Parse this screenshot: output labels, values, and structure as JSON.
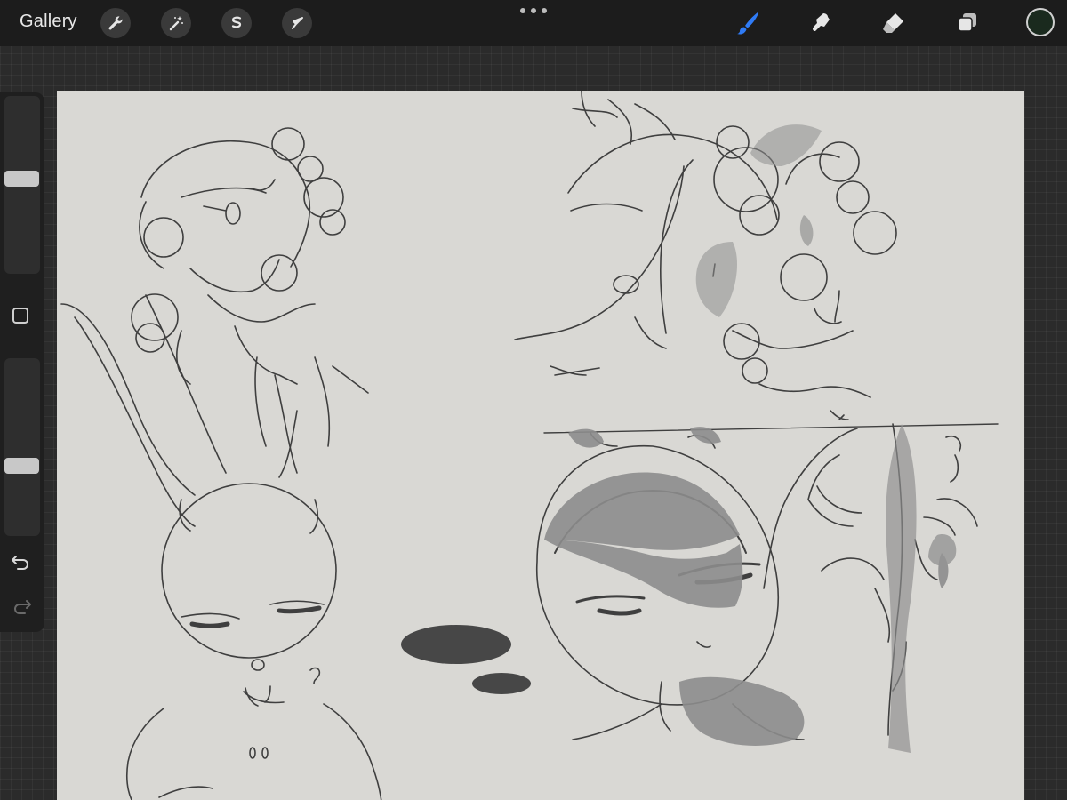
{
  "topbar": {
    "gallery_label": "Gallery",
    "left_tools": [
      "wrench-icon",
      "magic-wand-icon",
      "selection-icon",
      "transform-arrow-icon"
    ],
    "right_tools": [
      "brush-icon",
      "smudge-icon",
      "eraser-icon",
      "layers-icon"
    ],
    "active_tool": "brush-icon",
    "active_color": "#1a2a1e",
    "accent_color": "#2f7bf6"
  },
  "sidebar": {
    "brush_size_level": 0.62,
    "opacity_level": 0.7,
    "buttons": [
      "modify-square-icon",
      "undo-icon",
      "redo-icon"
    ]
  },
  "canvas": {
    "background": "#d9d8d4",
    "content": "sketch"
  }
}
